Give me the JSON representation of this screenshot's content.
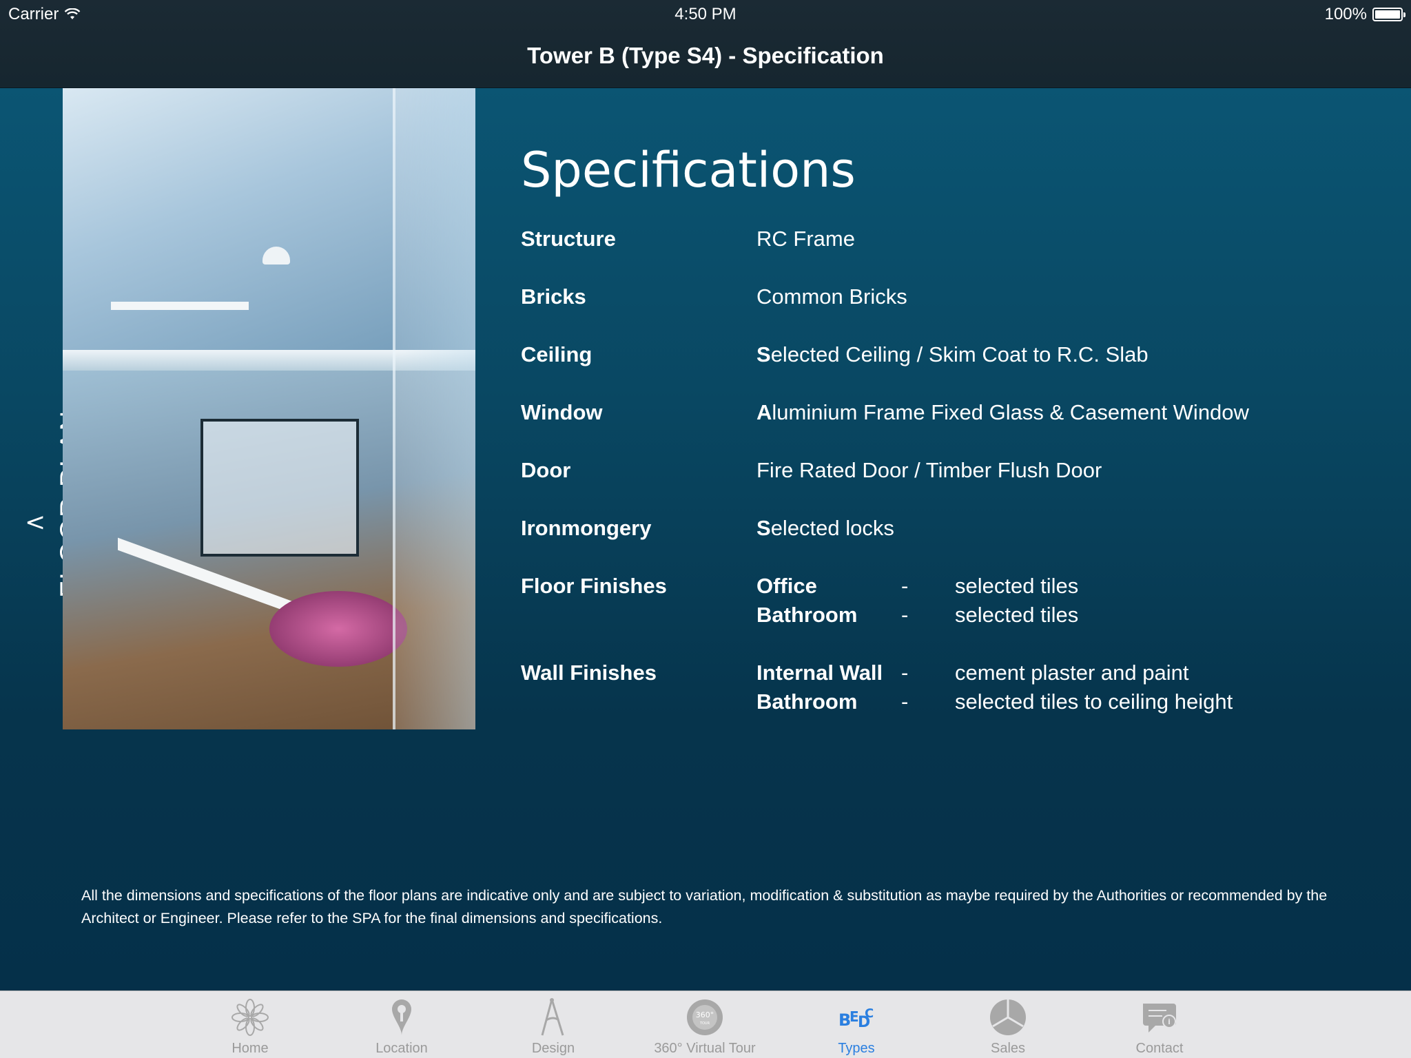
{
  "status_bar": {
    "carrier": "Carrier",
    "time": "4:50 PM",
    "battery": "100%"
  },
  "nav": {
    "title": "Tower B (Type S4) - Specification"
  },
  "side": {
    "back_glyph": "<",
    "floor_plan_label": "FLOOR PLAN"
  },
  "specs": {
    "heading": "Specifications",
    "rows": [
      {
        "label": "Structure",
        "value": "RC Frame"
      },
      {
        "label": "Bricks",
        "value": "Common Bricks"
      },
      {
        "label": "Ceiling",
        "value_first": "S",
        "value_rest": "elected Ceiling / Skim Coat to R.C. Slab"
      },
      {
        "label": "Window",
        "value_first": "A",
        "value_rest": "luminium Frame Fixed Glass & Casement Window"
      },
      {
        "label": "Door",
        "value": "Fire Rated Door / Timber Flush Door"
      },
      {
        "label": "Ironmongery",
        "value_first": "S",
        "value_rest": "elected locks"
      }
    ],
    "floor_finishes": {
      "label": "Floor Finishes",
      "items": [
        {
          "area": "Office",
          "dash": "-",
          "finish": "selected tiles"
        },
        {
          "area": "Bathroom",
          "dash": "-",
          "finish": "selected tiles"
        }
      ]
    },
    "wall_finishes": {
      "label": "Wall Finishes",
      "items": [
        {
          "area": "Internal Wall",
          "dash": "-",
          "finish": "cement plaster and paint"
        },
        {
          "area": "Bathroom",
          "dash": "-",
          "finish": "selected tiles to ceiling height"
        }
      ]
    }
  },
  "disclaimer": "All the dimensions and specifications of the floor plans are indicative only and are subject to variation, modification & substitution as maybe required by the Authorities or recommended by the Architect or Engineer. Please refer to the SPA for the final dimensions and specifications.",
  "tabs": [
    {
      "label": "Home",
      "icon": "flower-icon"
    },
    {
      "label": "Location",
      "icon": "location-pin-icon"
    },
    {
      "label": "Design",
      "icon": "compass-icon"
    },
    {
      "label": "360° Virtual Tour",
      "icon": "virtual-tour-360-icon"
    },
    {
      "label": "Types",
      "icon": "types-icon"
    },
    {
      "label": "Sales",
      "icon": "pie-chart-icon"
    },
    {
      "label": "Contact",
      "icon": "chat-info-icon"
    }
  ],
  "colors": {
    "active_tab": "#2a7fe0",
    "inactive_tab": "#9a9a9a",
    "background": "#0a3a55"
  }
}
